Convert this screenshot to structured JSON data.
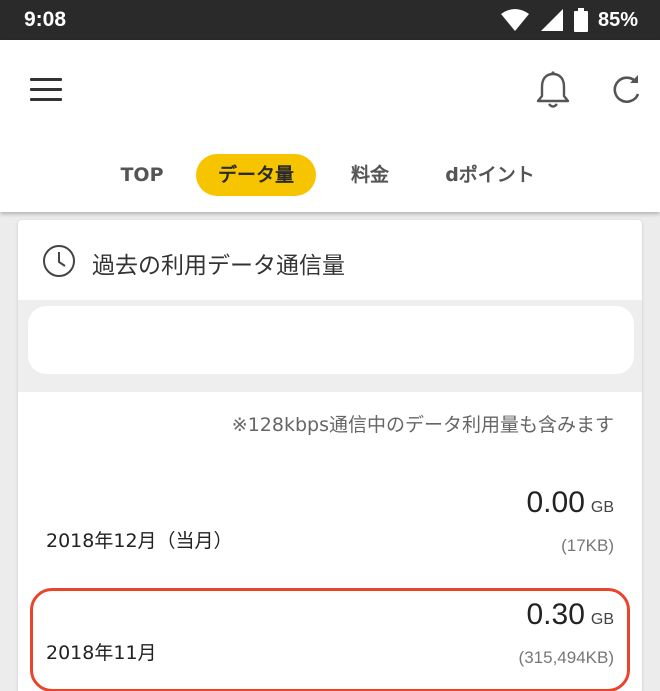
{
  "status_bar": {
    "time": "9:08",
    "battery": "85%",
    "icons": [
      "wifi-icon",
      "signal-icon",
      "battery-icon"
    ]
  },
  "app_bar": {
    "icons": [
      "menu-icon",
      "bell-icon",
      "refresh-icon"
    ]
  },
  "tabs": [
    {
      "label": "TOP",
      "active": false
    },
    {
      "label": "データ量",
      "active": true
    },
    {
      "label": "料金",
      "active": false
    },
    {
      "label": "dポイント",
      "active": false
    }
  ],
  "card": {
    "title": "過去の利用データ通信量",
    "note": "※128kbps通信中のデータ利用量も含みます",
    "rows": [
      {
        "month": "2018年12月（当月）",
        "amount": "0.00",
        "unit": "GB",
        "kb": "(17KB)",
        "highlighted": false
      },
      {
        "month": "2018年11月",
        "amount": "0.30",
        "unit": "GB",
        "kb": "(315,494KB)",
        "highlighted": true
      }
    ]
  },
  "colors": {
    "status_bar": "#2a2a2a",
    "active_tab": "#f7c500",
    "highlight_outline": "#e8452c",
    "background": "#ececec"
  }
}
